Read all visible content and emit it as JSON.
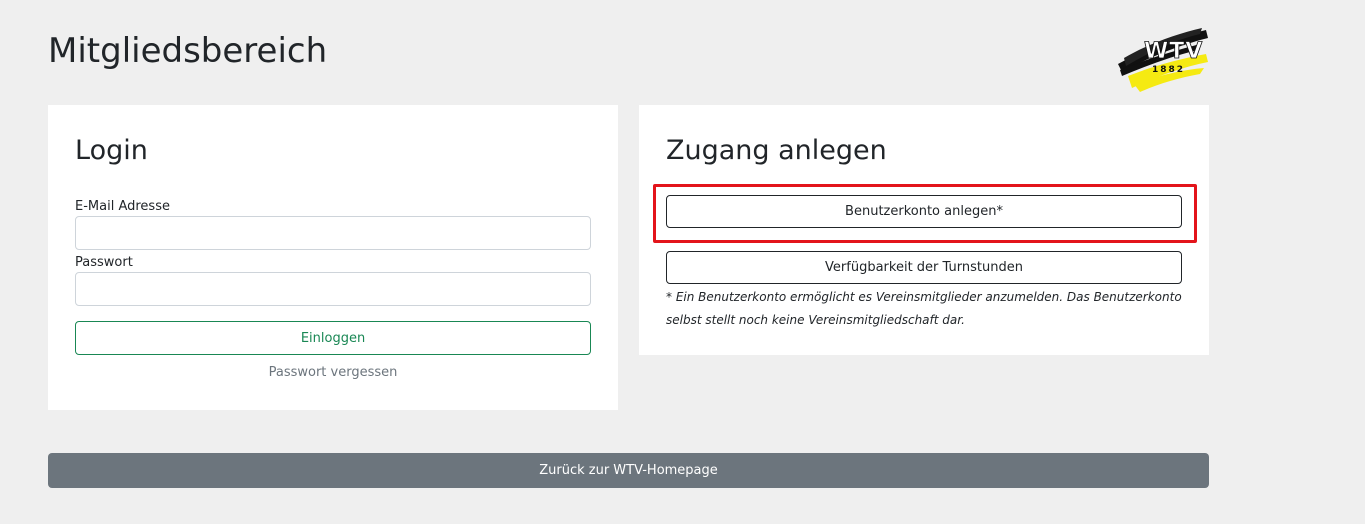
{
  "page": {
    "title": "Mitgliedsbereich"
  },
  "logo": {
    "text": "WTV",
    "year": "1882",
    "colors": [
      "#000000",
      "#f5e81a"
    ]
  },
  "login": {
    "title": "Login",
    "email_label": "E-Mail Adresse",
    "email_value": "",
    "email_placeholder": "",
    "password_label": "Passwort",
    "password_value": "",
    "password_placeholder": "",
    "submit_label": "Einloggen",
    "forgot_label": "Passwort vergessen"
  },
  "register": {
    "title": "Zugang anlegen",
    "create_account_label": "Benutzerkonto anlegen*",
    "availability_label": "Verfügbarkeit der Turnstunden",
    "note": "* Ein Benutzerkonto ermöglicht es Vereinsmitglieder anzumelden. Das Benutzerkonto selbst stellt noch keine Vereinsmitgliedschaft dar."
  },
  "footer": {
    "back_label": "Zurück zur WTV-Homepage"
  },
  "colors": {
    "background": "#efefef",
    "success": "#198754",
    "secondary": "#6c757d",
    "highlight": "#e3141b"
  }
}
